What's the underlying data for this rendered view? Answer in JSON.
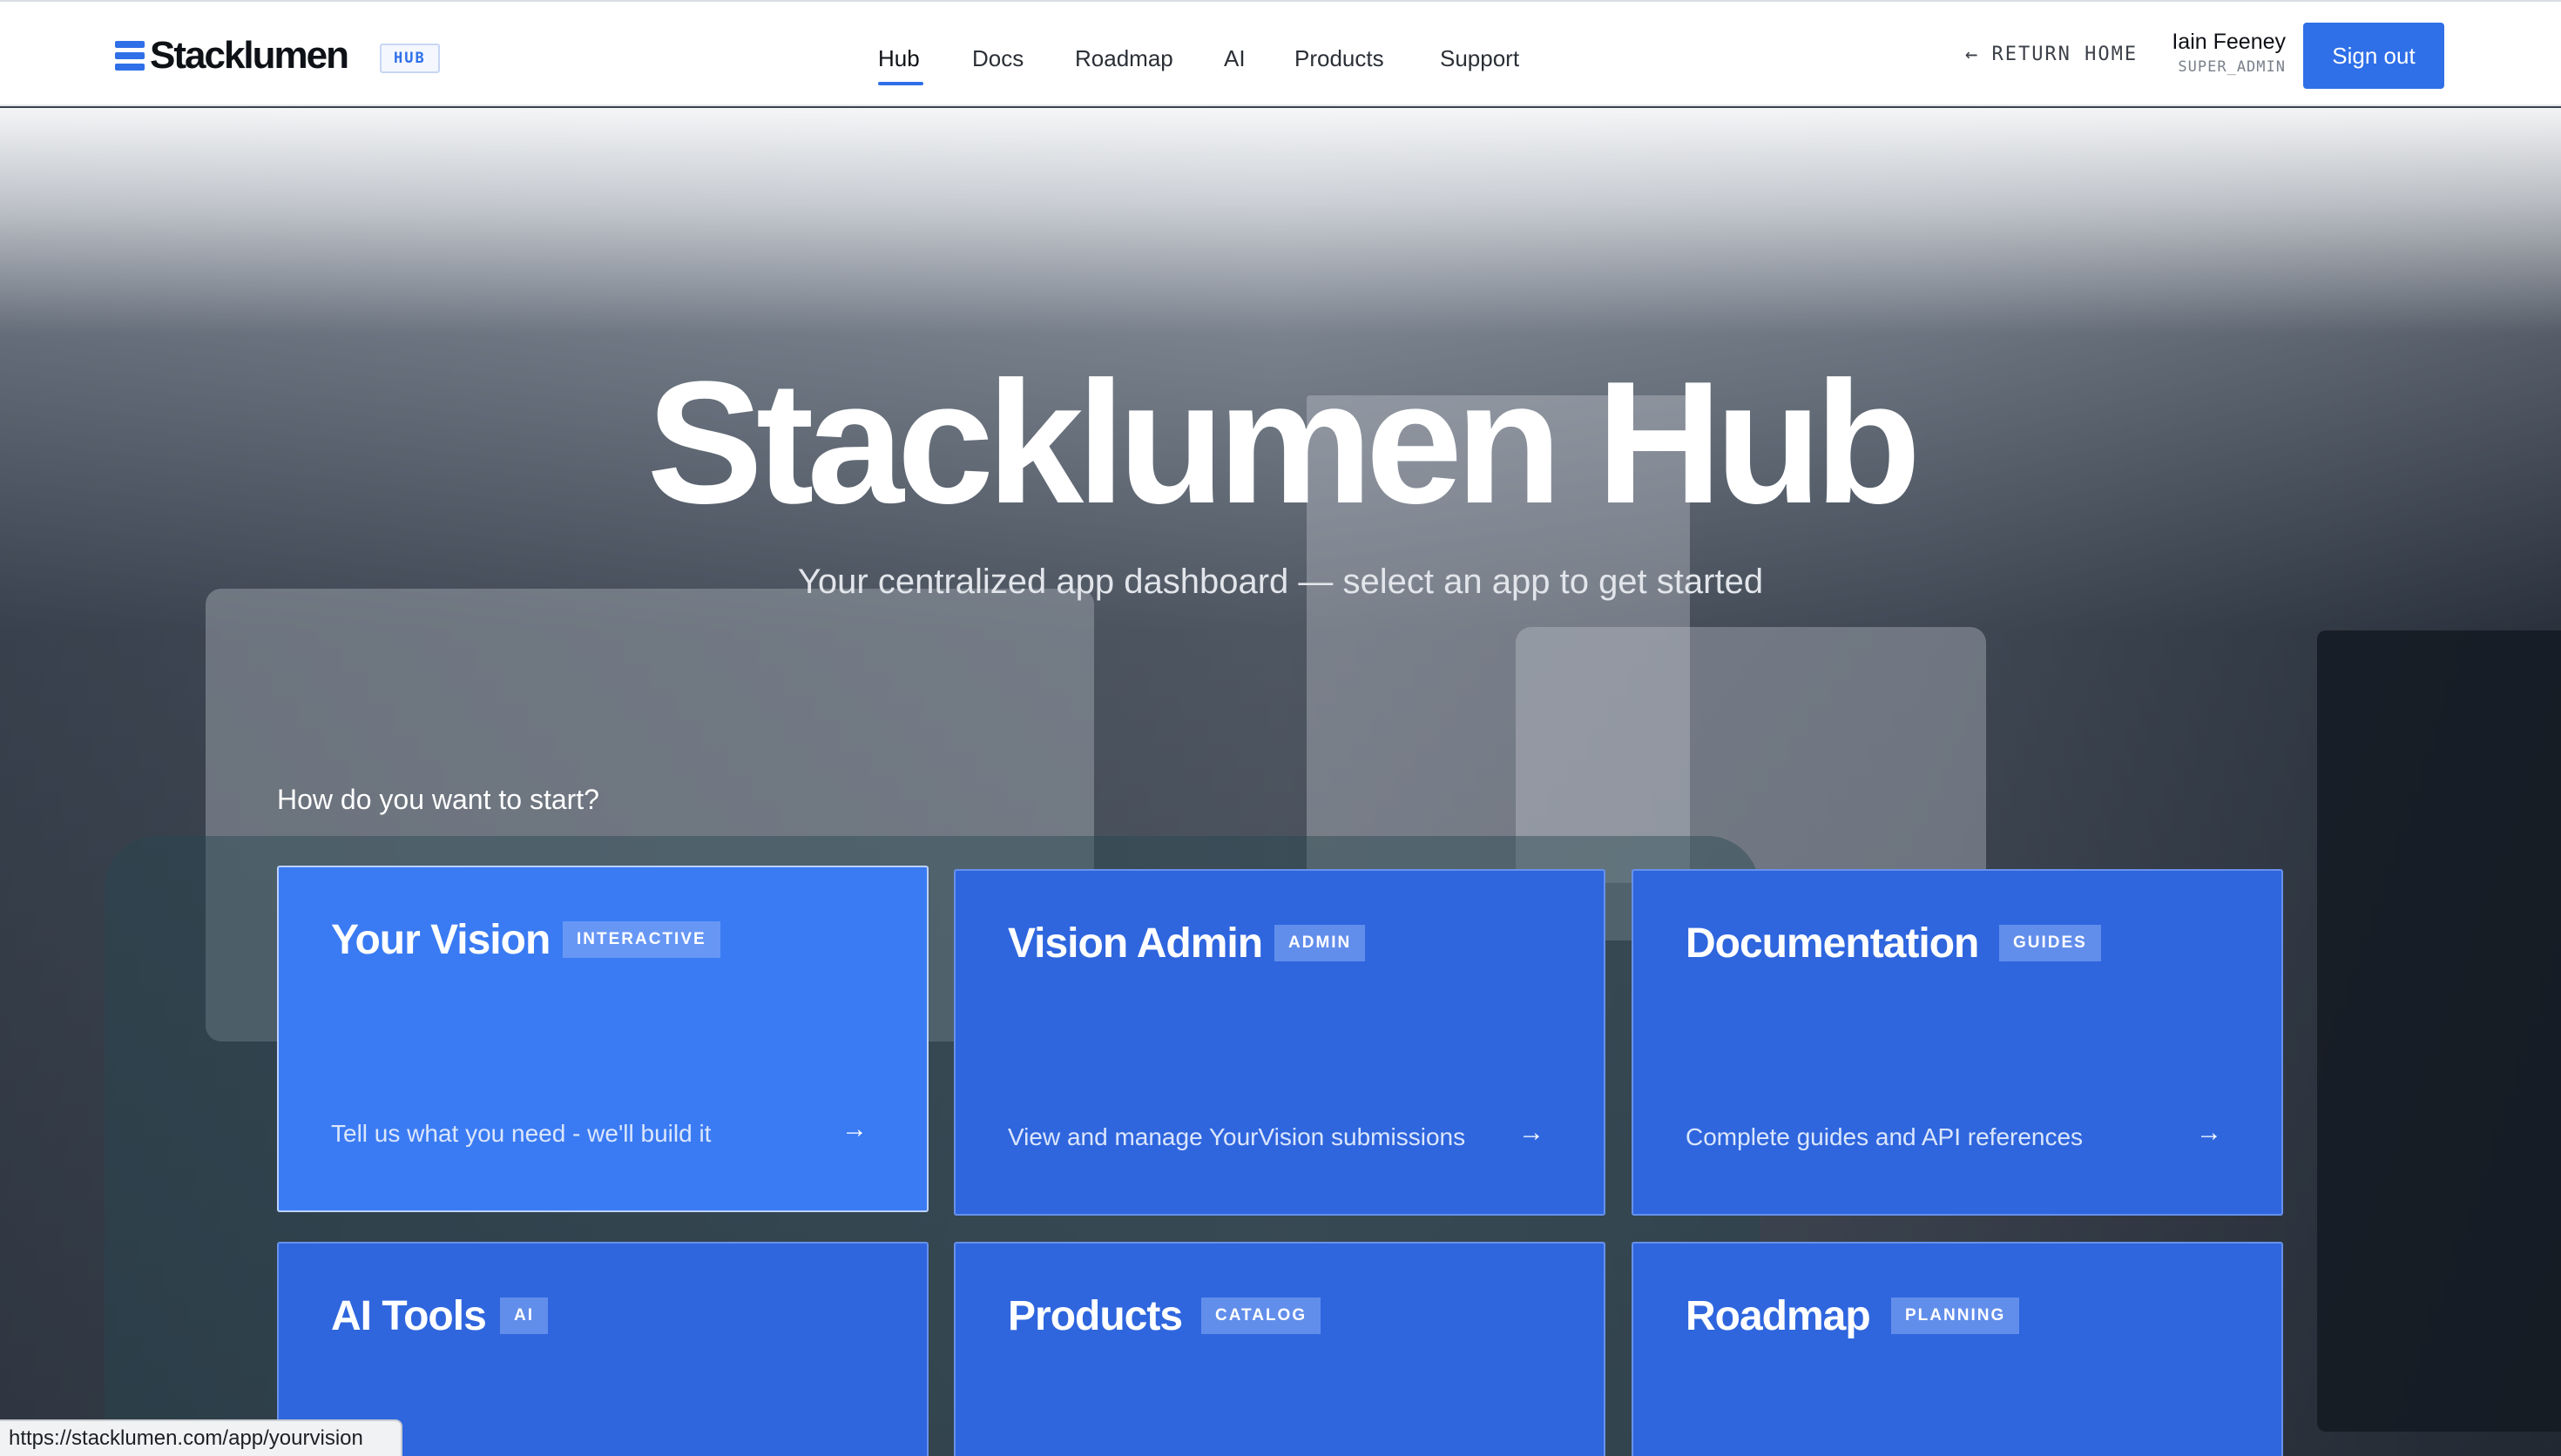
{
  "header": {
    "logo_text": "Stacklumen",
    "badge": "HUB",
    "nav": [
      "Hub",
      "Docs",
      "Roadmap",
      "AI",
      "Products",
      "Support"
    ],
    "active_nav": "Hub",
    "return_home": "RETURN HOME",
    "user_name": "Iain Feeney",
    "user_role": "SUPER_ADMIN",
    "signout": "Sign out"
  },
  "hero": {
    "title": "Stacklumen Hub",
    "subtitle": "Your centralized app dashboard — select an app to get started",
    "prompt": "How do you want to start?"
  },
  "cards": [
    {
      "title": "Your Vision",
      "tag": "INTERACTIVE",
      "desc": "Tell us what you need - we'll build it"
    },
    {
      "title": "Vision Admin",
      "tag": "ADMIN",
      "desc": "View and manage YourVision submissions"
    },
    {
      "title": "Documentation",
      "tag": "GUIDES",
      "desc": "Complete guides and API references"
    },
    {
      "title": "AI Tools",
      "tag": "AI",
      "desc": ""
    },
    {
      "title": "Products",
      "tag": "CATALOG",
      "desc": ""
    },
    {
      "title": "Roadmap",
      "tag": "PLANNING",
      "desc": ""
    }
  ],
  "status_url": "https://stacklumen.com/app/yourvision",
  "colors": {
    "accent": "#2f6fe8",
    "card": "#2f66de",
    "card_hover": "#3a7bf3"
  }
}
